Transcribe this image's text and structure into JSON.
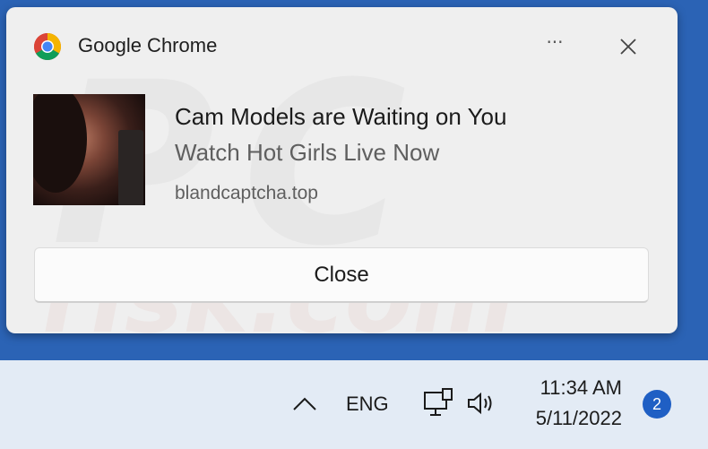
{
  "notification": {
    "app_name": "Google Chrome",
    "more_label": "···",
    "title": "Cam Models are Waiting on You",
    "subtitle": "Watch Hot Girls Live Now",
    "source": "blandcaptcha.top",
    "close_button_label": "Close",
    "app_icon": "chrome-icon",
    "dismiss_icon": "close-icon"
  },
  "watermark": {
    "line1": "PC",
    "line2": "risk.com"
  },
  "taskbar": {
    "language": "ENG",
    "time": "11:34 AM",
    "date": "5/11/2022",
    "notification_count": "2",
    "icons": [
      "chevron-up-icon",
      "network-icon",
      "volume-icon"
    ]
  },
  "colors": {
    "desktop": "#2b63b5",
    "toast_background": "#efefef",
    "taskbar": "#e3ebf5",
    "badge": "#1f5fc4"
  }
}
